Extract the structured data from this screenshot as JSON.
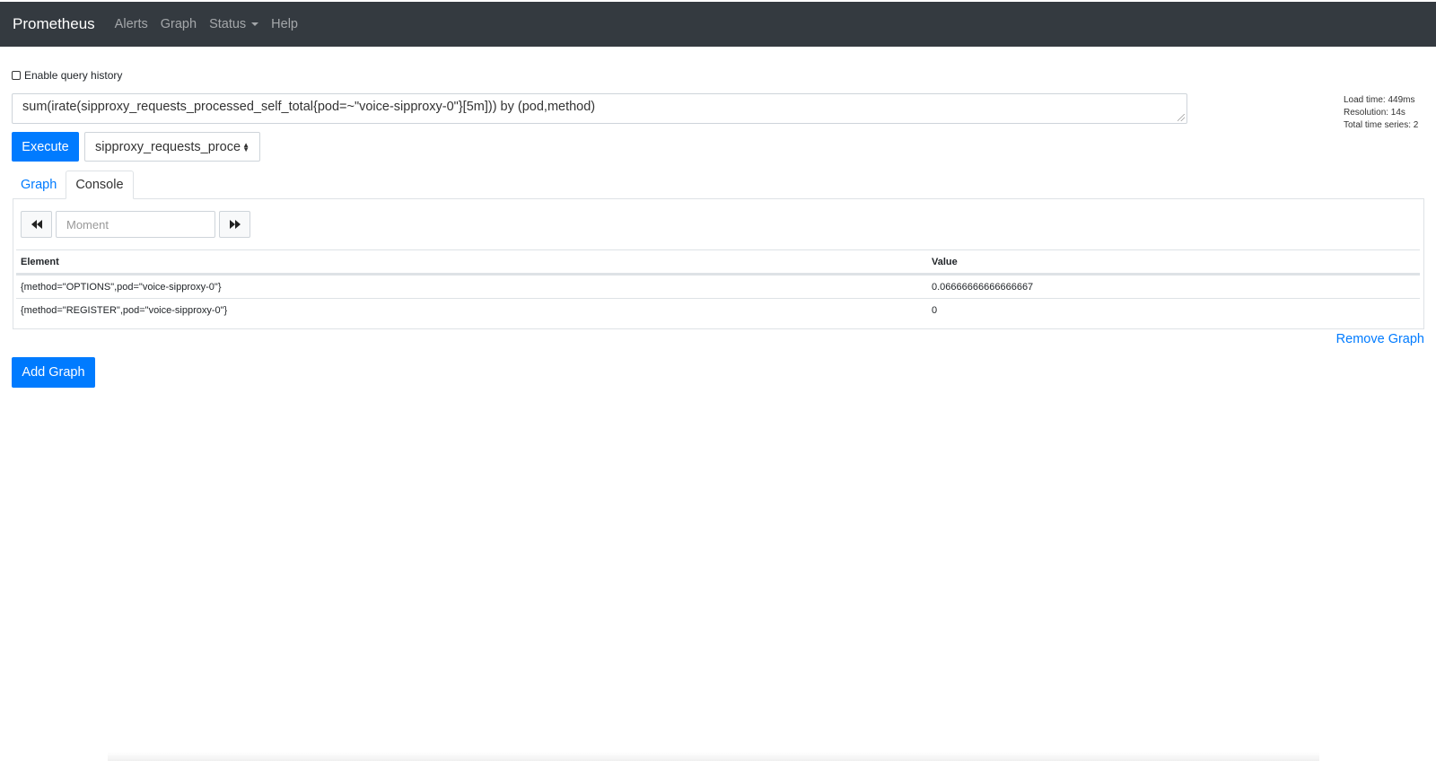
{
  "navbar": {
    "brand": "Prometheus",
    "items": [
      "Alerts",
      "Graph",
      "Status",
      "Help"
    ]
  },
  "history": {
    "label": "Enable query history",
    "checked": false
  },
  "query": {
    "expression": "sum(irate(sipproxy_requests_processed_self_total{pod=~\"voice-sipproxy-0\"}[5m])) by (pod,method)"
  },
  "stats": {
    "load_time": "Load time: 449ms",
    "resolution": "Resolution: 14s",
    "total_series": "Total time series: 2"
  },
  "execute_label": "Execute",
  "metric_select_value": "sipproxy_requests_proce",
  "tabs": [
    "Graph",
    "Console"
  ],
  "moment_placeholder": "Moment",
  "table": {
    "headers": [
      "Element",
      "Value"
    ],
    "rows": [
      [
        "{method=\"OPTIONS\",pod=\"voice-sipproxy-0\"}",
        "0.06666666666666667"
      ],
      [
        "{method=\"REGISTER\",pod=\"voice-sipproxy-0\"}",
        "0"
      ]
    ]
  },
  "remove_graph_label": "Remove Graph",
  "add_graph_label": "Add Graph",
  "colors": {
    "navbar": "#343a40",
    "primary": "#007bff"
  }
}
